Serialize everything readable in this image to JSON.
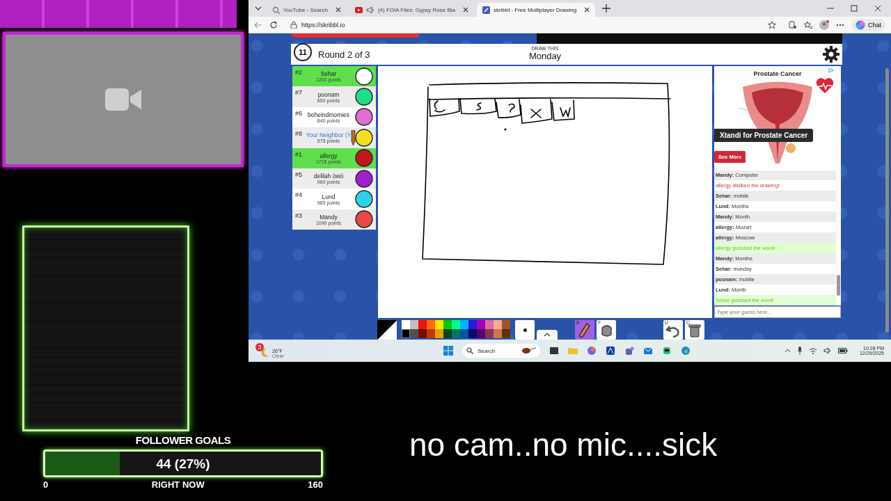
{
  "browser": {
    "tabs": [
      {
        "title": "YouTube - Search",
        "kind": "search",
        "selected": false
      },
      {
        "title": "(4) FOIA Files: Gypsy Rose Bla",
        "kind": "video",
        "selected": false
      },
      {
        "title": "skribbl - Free Multiplayer Drawing",
        "kind": "game",
        "selected": true
      }
    ],
    "url": "https://skribbl.io",
    "chat_button": "Chat"
  },
  "game": {
    "timer": "11",
    "round": "Round 2 of 3",
    "hint_label": "DRAW THIS",
    "word": "Monday",
    "players": [
      {
        "rank": "#2",
        "name": "Sehar",
        "points": "1200 points",
        "guessed": true,
        "drawing": false,
        "you": false,
        "color": "#ffffff"
      },
      {
        "rank": "#7",
        "name": "poonam",
        "points": "650 points",
        "guessed": false,
        "drawing": false,
        "you": false,
        "color": "#22dd88"
      },
      {
        "rank": "#6",
        "name": "beheindmomies",
        "points": "840 points",
        "guessed": false,
        "drawing": false,
        "you": false,
        "color": "#e070d0"
      },
      {
        "rank": "#8",
        "name": "Your Neighbor (Y",
        "points": "575 points",
        "guessed": false,
        "drawing": true,
        "you": true,
        "color": "#f0e020"
      },
      {
        "rank": "#1",
        "name": "allergy",
        "points": "1715 points",
        "guessed": true,
        "drawing": false,
        "you": false,
        "color": "#c01818"
      },
      {
        "rank": "#5",
        "name": "delilah òwó",
        "points": "960 points",
        "guessed": false,
        "drawing": false,
        "you": false,
        "color": "#a020d0"
      },
      {
        "rank": "#4",
        "name": "Lund",
        "points": "965 points",
        "guessed": false,
        "drawing": false,
        "you": false,
        "color": "#30d0e8"
      },
      {
        "rank": "#3",
        "name": "Mandy",
        "points": "1090 points",
        "guessed": false,
        "drawing": false,
        "you": false,
        "color": "#e84848"
      }
    ],
    "ad": {
      "title": "Prostate Cancer",
      "headline": "Xtandi for Prostate Cancer",
      "button": "See More"
    },
    "chat": [
      {
        "kind": "message",
        "author": "Mandy:",
        "text": "Computer"
      },
      {
        "kind": "disliked",
        "text": "allergy disliked the drawing!"
      },
      {
        "kind": "message",
        "author": "Sehar:",
        "text": "mobile"
      },
      {
        "kind": "message",
        "author": "Lund:",
        "text": "Months"
      },
      {
        "kind": "message",
        "author": "Mandy:",
        "text": "Month"
      },
      {
        "kind": "message",
        "author": "allergy:",
        "text": "Mozart"
      },
      {
        "kind": "message",
        "author": "allergy:",
        "text": "Moscow"
      },
      {
        "kind": "guessed",
        "text": "allergy guessed the word!"
      },
      {
        "kind": "message",
        "author": "Mandy:",
        "text": "Months"
      },
      {
        "kind": "message",
        "author": "Sehar:",
        "text": "mondsy"
      },
      {
        "kind": "message",
        "author": "poonam:",
        "text": "mobile"
      },
      {
        "kind": "message",
        "author": "Lund:",
        "text": "Month"
      },
      {
        "kind": "guessed",
        "text": "Sehar guessed the word!"
      }
    ],
    "guess_placeholder": "Type your guess here...",
    "palette": [
      {
        "color": "#ffffff",
        "selected": false
      },
      {
        "color": "#c1c1c1",
        "selected": false
      },
      {
        "color": "#ef130b",
        "selected": false
      },
      {
        "color": "#ff7100",
        "selected": false
      },
      {
        "color": "#ffe400",
        "selected": false
      },
      {
        "color": "#00cc00",
        "selected": false
      },
      {
        "color": "#00ff91",
        "selected": false
      },
      {
        "color": "#00b2ff",
        "selected": false
      },
      {
        "color": "#231fd3",
        "selected": false
      },
      {
        "color": "#a300ba",
        "selected": false
      },
      {
        "color": "#df69a7",
        "selected": false
      },
      {
        "color": "#ffac8e",
        "selected": false
      },
      {
        "color": "#a0522d",
        "selected": false
      },
      {
        "color": "#000000",
        "selected": true
      },
      {
        "color": "#505050",
        "selected": false
      },
      {
        "color": "#740b07",
        "selected": false
      },
      {
        "color": "#c23800",
        "selected": false
      },
      {
        "color": "#e8a200",
        "selected": false
      },
      {
        "color": "#004619",
        "selected": false
      },
      {
        "color": "#00785d",
        "selected": false
      },
      {
        "color": "#00569e",
        "selected": false
      },
      {
        "color": "#0e0865",
        "selected": false
      },
      {
        "color": "#550069",
        "selected": false
      },
      {
        "color": "#873554",
        "selected": false
      },
      {
        "color": "#cc774d",
        "selected": false
      },
      {
        "color": "#63300d",
        "selected": false
      }
    ],
    "tools": [
      {
        "key": "B",
        "kind": "pencil",
        "selected": true
      },
      {
        "key": "F",
        "kind": "fill",
        "selected": false
      }
    ],
    "actions": [
      {
        "key": "U",
        "kind": "undo"
      },
      {
        "key": "C",
        "kind": "clear"
      }
    ]
  },
  "taskbar": {
    "weather_badge": "3",
    "temperature": "26°F",
    "condition": "Clear",
    "search": "Search",
    "time": "10:28 PM",
    "date": "12/29/2025"
  },
  "follower_goal": {
    "title": "FOLLOWER GOALS",
    "value": "44 (27%)",
    "level": 0.27,
    "min": "0",
    "current_label": "RIGHT NOW",
    "max": "160"
  },
  "caption": "no cam..no mic....sick"
}
